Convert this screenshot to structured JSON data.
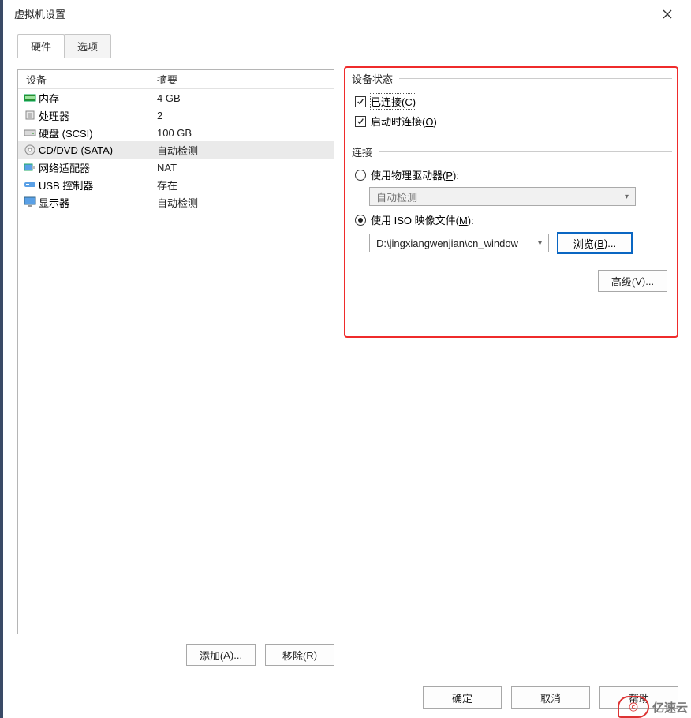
{
  "window": {
    "title": "虚拟机设置"
  },
  "tabs": {
    "hardware": "硬件",
    "options": "选项"
  },
  "list": {
    "header_device": "设备",
    "header_summary": "摘要",
    "rows": [
      {
        "icon": "memory-icon",
        "label": "内存",
        "summary": "4 GB"
      },
      {
        "icon": "cpu-icon",
        "label": "处理器",
        "summary": "2"
      },
      {
        "icon": "hdd-icon",
        "label": "硬盘 (SCSI)",
        "summary": "100 GB"
      },
      {
        "icon": "cd-icon",
        "label": "CD/DVD (SATA)",
        "summary": "自动检测"
      },
      {
        "icon": "nic-icon",
        "label": "网络适配器",
        "summary": "NAT"
      },
      {
        "icon": "usb-icon",
        "label": "USB 控制器",
        "summary": "存在"
      },
      {
        "icon": "display-icon",
        "label": "显示器",
        "summary": "自动检测"
      }
    ]
  },
  "left_buttons": {
    "add": "添加(",
    "add_u": "A",
    "add_tail": ")...",
    "remove": "移除(",
    "remove_u": "R",
    "remove_tail": ")"
  },
  "right": {
    "status_title": "设备状态",
    "connected_prefix": "已连接(",
    "connected_u": "C",
    "connected_suffix": ")",
    "connect_at_poweron_prefix": "启动时连接(",
    "connect_at_poweron_u": "O",
    "connect_at_poweron_suffix": ")",
    "connection_title": "连接",
    "physical_prefix": "使用物理驱动器(",
    "physical_u": "P",
    "physical_suffix": "):",
    "physical_combo": "自动检测",
    "iso_prefix": "使用 ISO 映像文件(",
    "iso_u": "M",
    "iso_suffix": "):",
    "iso_path": "D:\\jingxiangwenjian\\cn_window",
    "browse_prefix": "浏览(",
    "browse_u": "B",
    "browse_suffix": ")...",
    "advanced_prefix": "高级(",
    "advanced_u": "V",
    "advanced_suffix": ")..."
  },
  "footer": {
    "ok": "确定",
    "cancel": "取消",
    "help": "帮助"
  },
  "watermark": "亿速云"
}
